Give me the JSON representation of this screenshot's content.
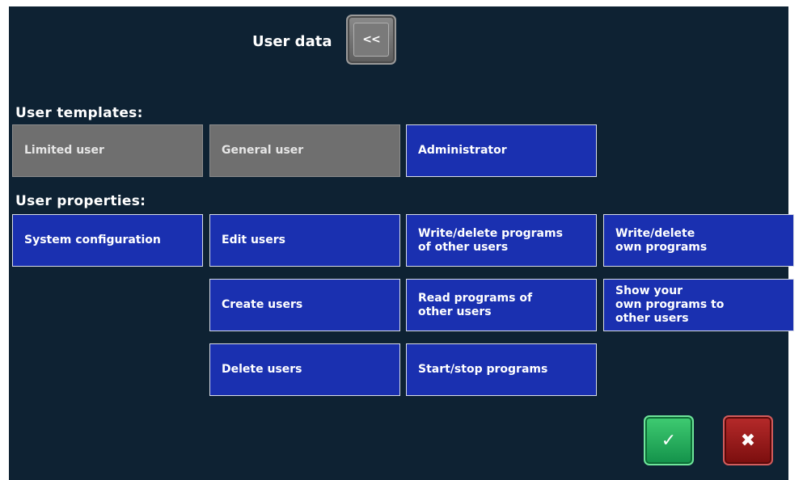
{
  "header": {
    "title": "User data",
    "back_label": "<<"
  },
  "templates": {
    "label": "User templates:",
    "items": [
      {
        "label": "Limited user"
      },
      {
        "label": "General user"
      },
      {
        "label": "Administrator"
      }
    ]
  },
  "properties": {
    "label": "User properties:",
    "items": [
      {
        "label": "System configuration"
      },
      {
        "label": "Edit users"
      },
      {
        "label": "Write/delete programs\nof other users"
      },
      {
        "label": "Write/delete\nown programs"
      },
      {
        "label": "Create users"
      },
      {
        "label": "Read programs of\nother users"
      },
      {
        "label": "Show your\nown programs to\nother users"
      },
      {
        "label": "Delete users"
      },
      {
        "label": "Start/stop programs"
      }
    ]
  },
  "footer": {
    "confirm_glyph": "✓",
    "cancel_glyph": "✖"
  },
  "colors": {
    "background": "#0e2233",
    "selected_tile": "#1a30b0",
    "unselected_tile": "#6f6f6f",
    "confirm": "#1fa552",
    "cancel": "#9a1a1a"
  }
}
